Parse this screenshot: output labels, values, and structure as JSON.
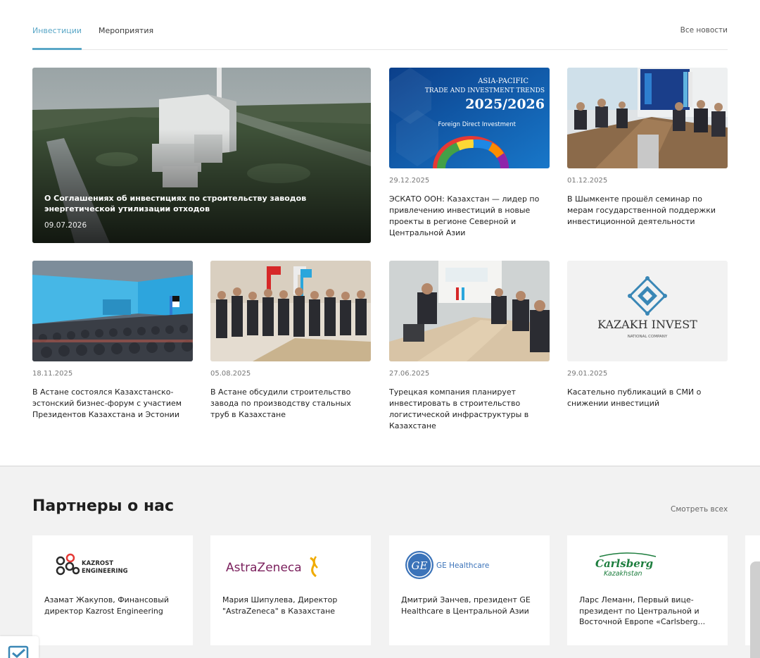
{
  "tabs": {
    "investments": "Инвестиции",
    "events": "Мероприятия",
    "all_news": "Все новости"
  },
  "featured": {
    "title": "О Соглашениях об инвестициях по строительству заводов энергетической утилизации отходов",
    "date": "09.07.2026"
  },
  "news": [
    {
      "date": "29.12.2025",
      "title": "ЭСКАТО ООН: Казахстан — лидер по привлечению инвестиций в новые проекты в регионе Северной и Центральной Азии"
    },
    {
      "date": "01.12.2025",
      "title": "В Шымкенте прошёл семинар по мерам государственной поддержки инвестиционной деятельности"
    },
    {
      "date": "18.11.2025",
      "title": "В Астане состоялся Казахстанско-эстонский бизнес-форум с участием Президентов Казахстана и Эстонии"
    },
    {
      "date": "05.08.2025",
      "title": "В Астане обсудили строительство завода по производству стальных труб в Казахстане"
    },
    {
      "date": "27.06.2025",
      "title": "Турецкая компания планирует инвестировать в строительство логистической инфраструктуры в Казахстане"
    },
    {
      "date": "29.01.2025",
      "title": "Касательно публикаций в СМИ о снижении инвестиций"
    }
  ],
  "images": {
    "asia_pacific": {
      "line1": "ASIA-PACIFIC",
      "line2": "TRADE AND INVESTMENT TRENDS",
      "line3": "2025/2026",
      "line4": "Foreign Direct Investment"
    },
    "kazakh_invest": {
      "name": "KAZAKH INVEST",
      "sub": "NATIONAL COMPANY"
    }
  },
  "partners": {
    "title": "Партнеры о нас",
    "see_all": "Смотреть всех",
    "items": [
      {
        "logo": "KAZROST ENGINEERING",
        "text": "Азамат Жакупов, Финансовый директор Kazrost Engineering"
      },
      {
        "logo": "AstraZeneca",
        "text": "Мария Шипулева, Директор \"AstraZeneca\" в Казахстане"
      },
      {
        "logo": "GE Healthcare",
        "text": "Дмитрий Занчев, президент GE Healthcare в Центральной Азии"
      },
      {
        "logo": "Carlsberg Kazakhstan",
        "text": "Ларс Леманн, Первый вице-президент по Центральной и Восточной Европе «Carlsberg..."
      }
    ]
  },
  "colors": {
    "accent": "#5aa7c7",
    "partners_bg": "#f2f2f2"
  }
}
